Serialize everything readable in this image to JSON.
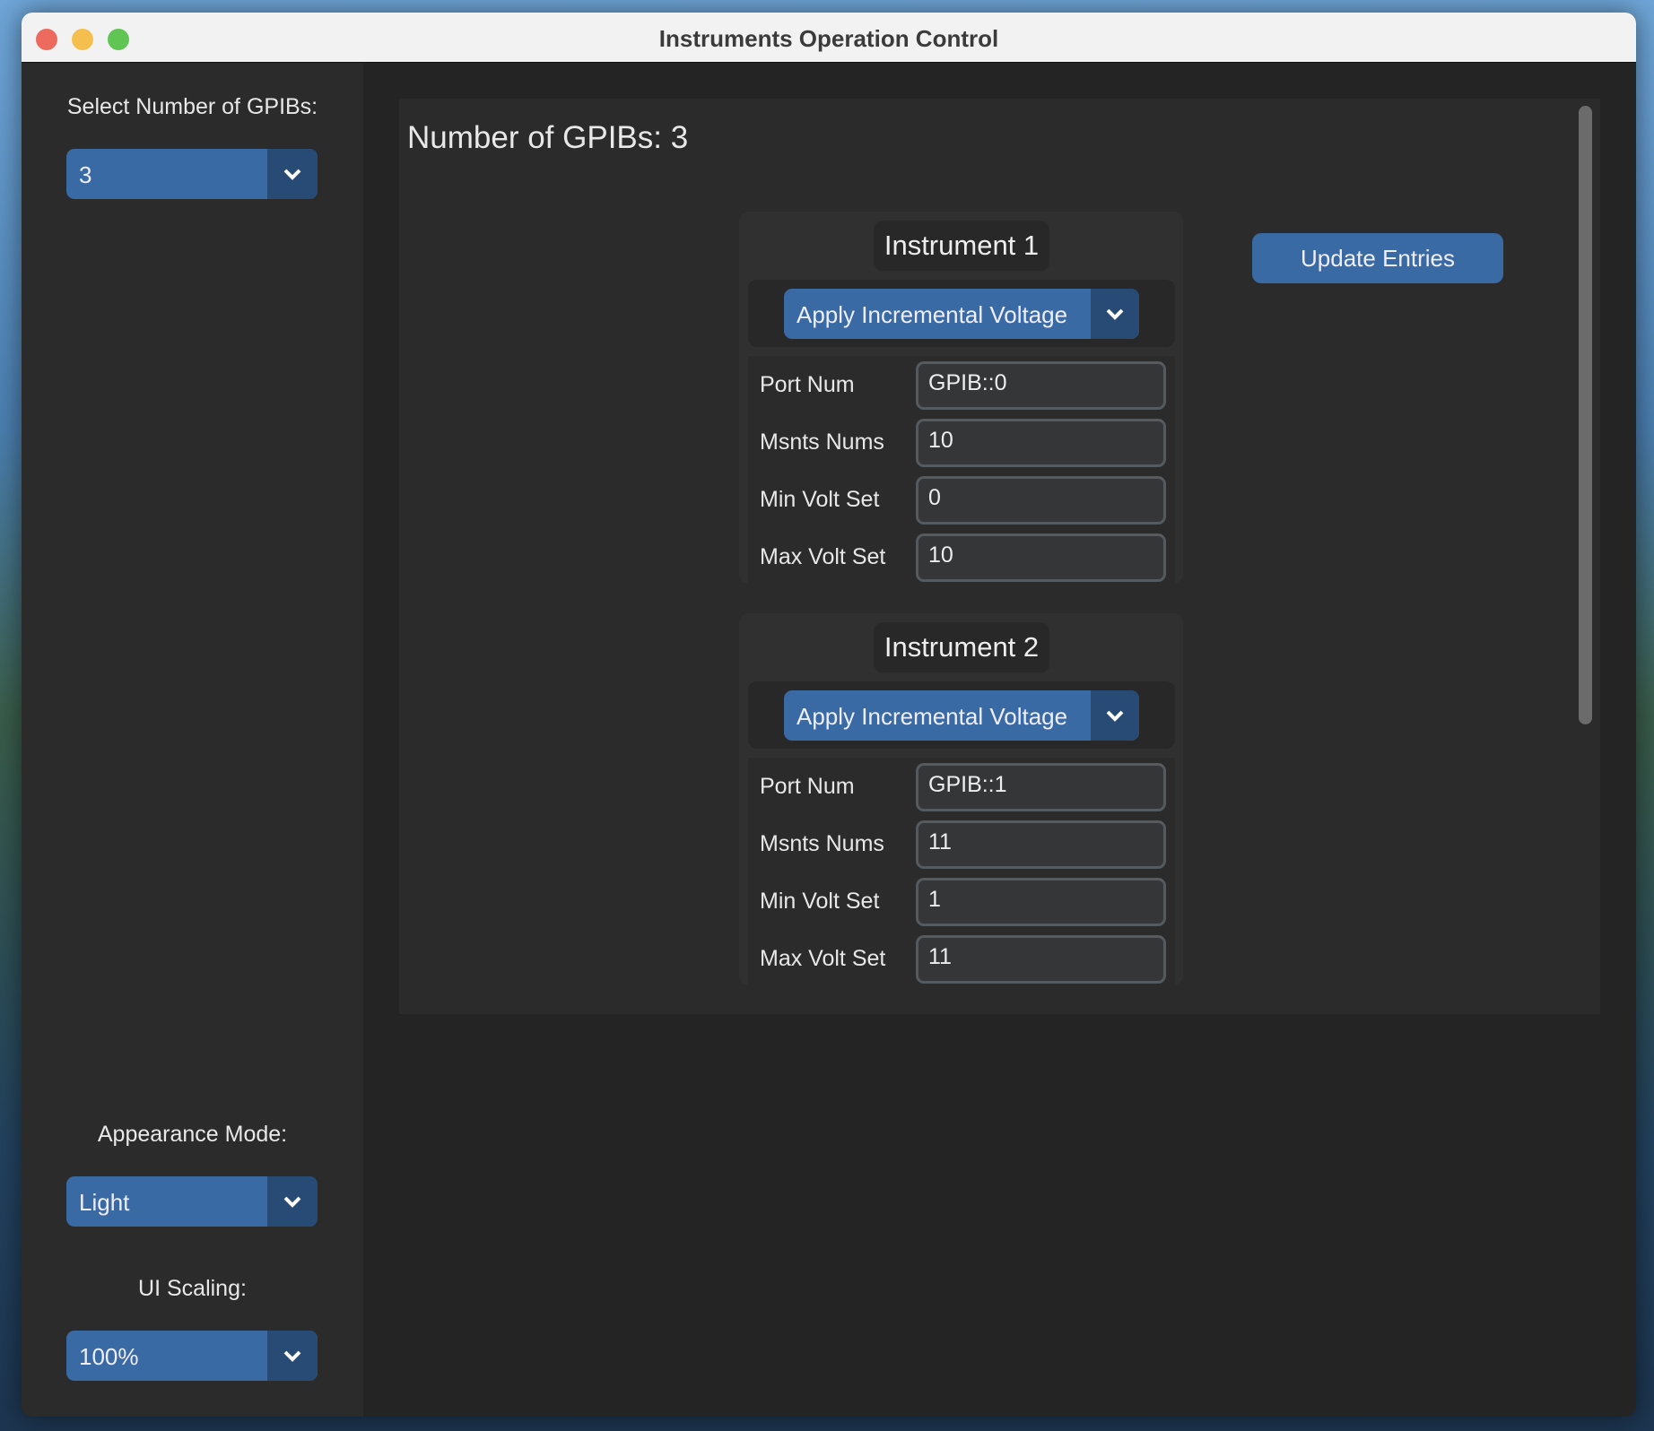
{
  "window": {
    "title": "Instruments Operation Control"
  },
  "sidebar": {
    "gpib_label": "Select Number of GPIBs:",
    "gpib_value": "3",
    "appearance_label": "Appearance Mode:",
    "appearance_value": "Light",
    "scaling_label": "UI Scaling:",
    "scaling_value": "100%"
  },
  "main": {
    "title": "Number of GPIBs: 3",
    "update_button": "Update Entries",
    "instruments": [
      {
        "title": "Instrument 1",
        "mode": "Apply Incremental Voltage",
        "fields": [
          {
            "label": "Port Num",
            "value": "GPIB::0"
          },
          {
            "label": "Msnts Nums",
            "value": "10"
          },
          {
            "label": "Min Volt Set",
            "value": "0"
          },
          {
            "label": "Max Volt Set",
            "value": "10"
          }
        ]
      },
      {
        "title": "Instrument 2",
        "mode": "Apply Incremental Voltage",
        "fields": [
          {
            "label": "Port Num",
            "value": "GPIB::1"
          },
          {
            "label": "Msnts Nums",
            "value": "11"
          },
          {
            "label": "Min Volt Set",
            "value": "1"
          },
          {
            "label": "Max Volt Set",
            "value": "11"
          }
        ]
      }
    ]
  },
  "colors": {
    "accent": "#3a6aa3",
    "accent_dark": "#284b76",
    "background": "#242424"
  }
}
